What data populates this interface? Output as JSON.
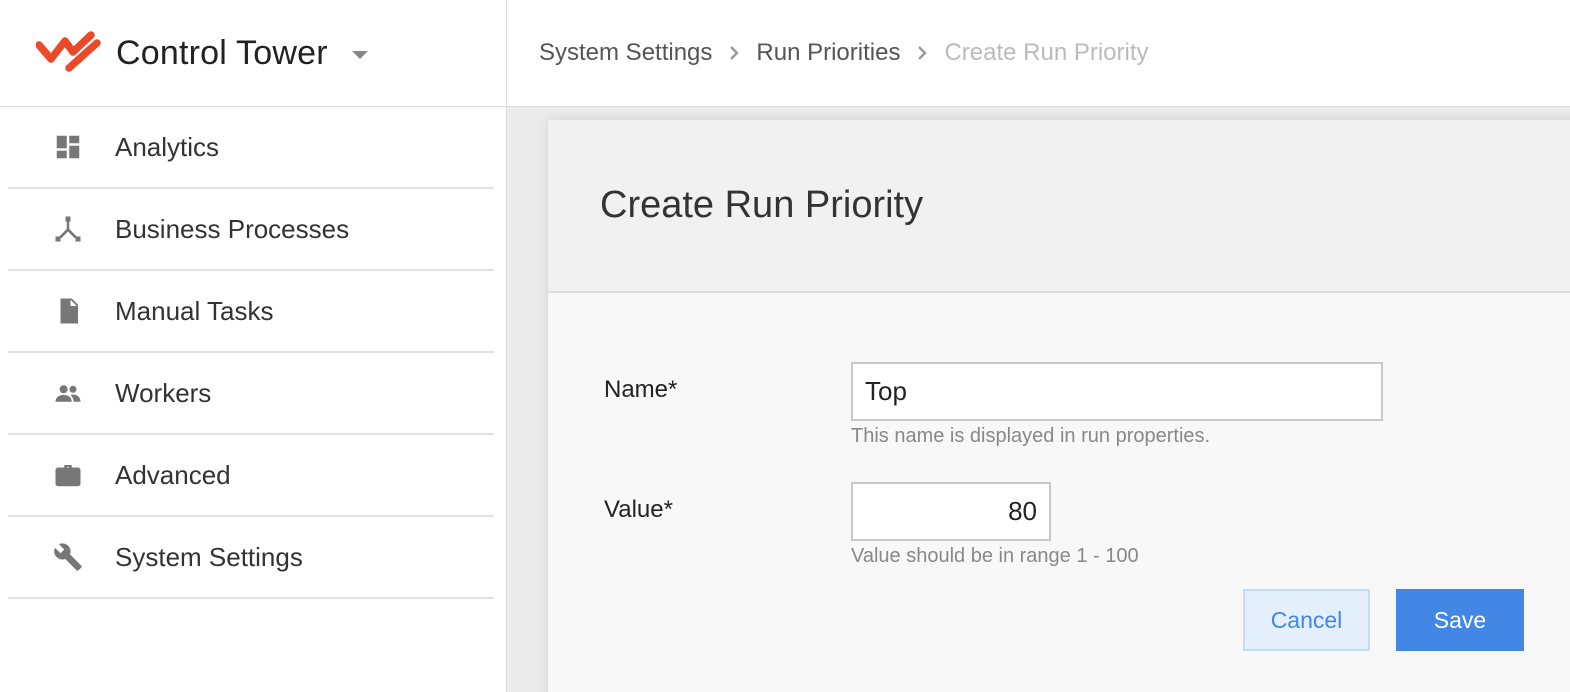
{
  "app": {
    "title": "Control Tower"
  },
  "sidebar": {
    "items": [
      {
        "label": "Analytics",
        "icon": "dashboard-icon"
      },
      {
        "label": "Business Processes",
        "icon": "process-icon"
      },
      {
        "label": "Manual Tasks",
        "icon": "document-icon"
      },
      {
        "label": "Workers",
        "icon": "people-icon"
      },
      {
        "label": "Advanced",
        "icon": "briefcase-icon"
      },
      {
        "label": "System Settings",
        "icon": "wrench-icon"
      }
    ]
  },
  "breadcrumb": {
    "items": [
      "System Settings",
      "Run Priorities",
      "Create Run Priority"
    ]
  },
  "page": {
    "title": "Create Run Priority"
  },
  "form": {
    "name": {
      "label": "Name*",
      "value": "Top",
      "hint": "This name is displayed in run properties."
    },
    "value": {
      "label": "Value*",
      "value": "80",
      "hint": "Value should be in range 1 - 100"
    },
    "cancel_label": "Cancel",
    "save_label": "Save"
  },
  "colors": {
    "brand": "#ea4a2a",
    "accent": "#4287e6",
    "icon": "#777777"
  }
}
